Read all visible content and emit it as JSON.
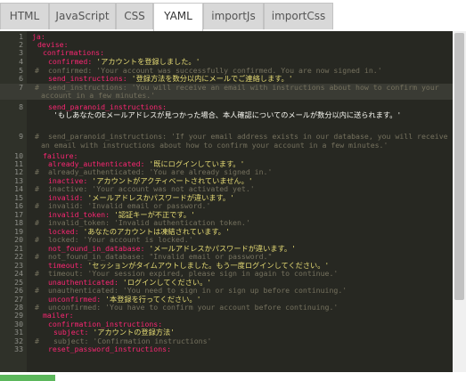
{
  "tabs": [
    {
      "label": "HTML"
    },
    {
      "label": "JavaScript"
    },
    {
      "label": "CSS"
    },
    {
      "label": "YAML"
    },
    {
      "label": "importJs"
    },
    {
      "label": "importCss"
    }
  ],
  "editor": {
    "lines": [
      {
        "num": "1",
        "key": "ja:",
        "val": "",
        "cls": "k"
      },
      {
        "num": "2",
        "key": "devise:",
        "val": "",
        "cls": "k"
      },
      {
        "num": "3",
        "key": "confirmations:",
        "val": "",
        "cls": "k"
      },
      {
        "num": "4",
        "key": "confirmed:",
        "val": " 'アカウントを登録しました。'",
        "cls": "k"
      },
      {
        "num": "5",
        "hash": "#",
        "comment": "confirmed: 'Your account was successfully confirmed. You are now signed in.'"
      },
      {
        "num": "6",
        "key": "send_instructions:",
        "val": " '登録方法を数分以内にメールでご連絡します。'",
        "cls": "k"
      },
      {
        "num": "7",
        "hash": "#",
        "comment": "send_instructions: 'You will receive an email with instructions about how to confirm your",
        "wrap": "account in a few minutes.'"
      },
      {
        "num": "8",
        "key": "send_paranoid_instructions:",
        "val": "",
        "cls": "k",
        "cont": "'もしあなたのEメールアドレスが見つかった場合、本人確認についてのメールが数分以内に送られます。'"
      },
      {
        "num": "9",
        "hash": "#",
        "comment": "send_paranoid_instructions: 'If your email address exists in our database, you will receive",
        "wrap": "an email with instructions about how to confirm your account in a few minutes.'"
      },
      {
        "num": "10",
        "key": "failure:",
        "val": "",
        "cls": "k"
      },
      {
        "num": "11",
        "key": "already_authenticated:",
        "val": " '既にログインしています。'",
        "cls": "k"
      },
      {
        "num": "12",
        "hash": "#",
        "comment": "already_authenticated: 'You are already signed in.'"
      },
      {
        "num": "13",
        "key": "inactive:",
        "val": " 'アカウントがアクティベートされていません。'",
        "cls": "k"
      },
      {
        "num": "14",
        "hash": "#",
        "comment": "inactive: 'Your account was not activated yet.'"
      },
      {
        "num": "15",
        "key": "invalid:",
        "val": " 'メールアドレスかパスワードが違います。'",
        "cls": "k"
      },
      {
        "num": "16",
        "hash": "#",
        "comment": "invalid: 'Invalid email or password.'"
      },
      {
        "num": "17",
        "key": "invalid_token:",
        "val": " '認証キーが不正です。'",
        "cls": "k"
      },
      {
        "num": "18",
        "hash": "#",
        "comment": "invalid_token: 'Invalid authentication token.'"
      },
      {
        "num": "19",
        "key": "locked:",
        "val": " 'あなたのアカウントは凍結されています。'",
        "cls": "k"
      },
      {
        "num": "20",
        "hash": "#",
        "comment": "locked: 'Your account is locked.'"
      },
      {
        "num": "21",
        "key": "not_found_in_database:",
        "val": " 'メールアドレスかパスワードが違います。'",
        "cls": "k"
      },
      {
        "num": "22",
        "hash": "#",
        "comment": "not_found_in_database: \"Invalid email or password.\""
      },
      {
        "num": "23",
        "key": "timeout:",
        "val": " 'セッションがタイムアウトしました。もう一度ログインしてください。'",
        "cls": "k"
      },
      {
        "num": "24",
        "hash": "#",
        "comment": "timeout: 'Your session expired, please sign in again to continue.'"
      },
      {
        "num": "25",
        "key": "unauthenticated:",
        "val": " 'ログインしてください。'",
        "cls": "k"
      },
      {
        "num": "26",
        "hash": "#",
        "comment": "unauthenticated: 'You need to sign in or sign up before continuing.'"
      },
      {
        "num": "27",
        "key": "unconfirmed:",
        "val": " '本登録を行ってください。'",
        "cls": "k"
      },
      {
        "num": "28",
        "hash": "#",
        "comment": "unconfirmed: 'You have to confirm your account before continuing.'"
      },
      {
        "num": "29",
        "key": "mailer:",
        "val": "",
        "cls": "k"
      },
      {
        "num": "30",
        "key": "confirmation_instructions:",
        "val": "",
        "cls": "k"
      },
      {
        "num": "31",
        "key": "subject:",
        "val": " 'アカウントの登録方法'",
        "cls": "k"
      },
      {
        "num": "32",
        "hash": "#",
        "comment": "subject: 'Confirmation instructions'"
      },
      {
        "num": "33",
        "key": "reset_password_instructions:",
        "val": "",
        "cls": "k"
      }
    ]
  },
  "colors": {
    "editor_bg": "#272822",
    "key": "#f92672",
    "string": "#e6db74",
    "comment": "#75715e",
    "accent": "#5cb85c"
  }
}
